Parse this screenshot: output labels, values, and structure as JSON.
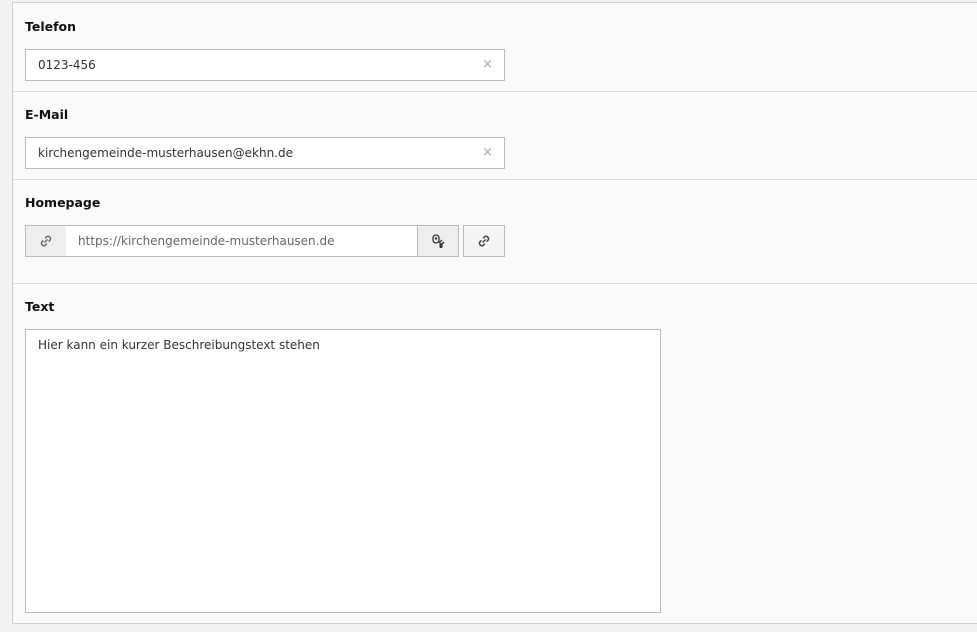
{
  "fields": {
    "telefon": {
      "label": "Telefon",
      "value": "0123-456",
      "clear_glyph": "×"
    },
    "email": {
      "label": "E-Mail",
      "value": "kirchengemeinde-musterhausen@ekhn.de",
      "clear_glyph": "×"
    },
    "homepage": {
      "label": "Homepage",
      "value": "https://kirchengemeinde-musterhausen.de",
      "prefix_icon": "link-icon",
      "explode_icon": "unlink-explode-icon",
      "link_button_icon": "link-icon"
    },
    "text": {
      "label": "Text",
      "value": "Hier kann ein kurzer Beschreibungstext stehen"
    }
  },
  "colors": {
    "panel_background": "#fafafa",
    "page_background": "#f2f2f2",
    "input_border": "#bbbbbb",
    "addon_background": "#eeeeee"
  }
}
